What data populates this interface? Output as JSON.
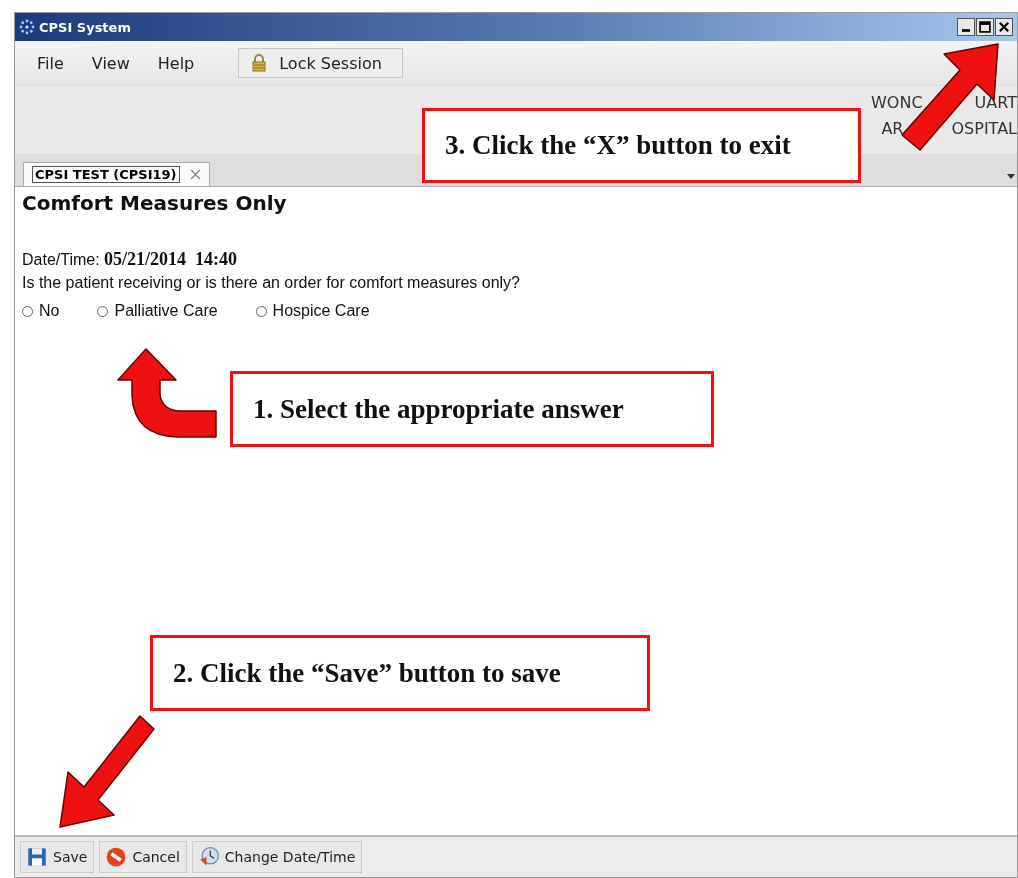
{
  "window": {
    "title": "CPSI System"
  },
  "menu": [
    "File",
    "View",
    "Help"
  ],
  "toolbar": {
    "lock_button": "Lock Session"
  },
  "header": {
    "line_1": [
      "WONC",
      "UART"
    ],
    "line_2": [
      "AR",
      "OSPITAL"
    ]
  },
  "tabs": [
    {
      "label": "CPSI TEST (CPSI19)",
      "selected": true
    }
  ],
  "form": {
    "title": "Comfort Measures Only",
    "datetime_label": "Date/Time:",
    "datetime_value": "05/21/2014  14:40",
    "question": "Is the patient receiving or is there an order for comfort measures only?",
    "options": [
      {
        "label": "No",
        "selected": false
      },
      {
        "label": "Palliative Care",
        "selected": false
      },
      {
        "label": "Hospice Care",
        "selected": false
      }
    ]
  },
  "buttons": [
    {
      "kind": "save",
      "label": "Save"
    },
    {
      "kind": "cancel",
      "label": "Cancel"
    },
    {
      "kind": "datetime",
      "label": "Change Date/Time"
    }
  ],
  "callouts": [
    {
      "text": "3. Click the “X” button to exit"
    },
    {
      "text": "1. Select the appropriate answer"
    },
    {
      "text": "2. Click the “Save” button to save"
    }
  ]
}
